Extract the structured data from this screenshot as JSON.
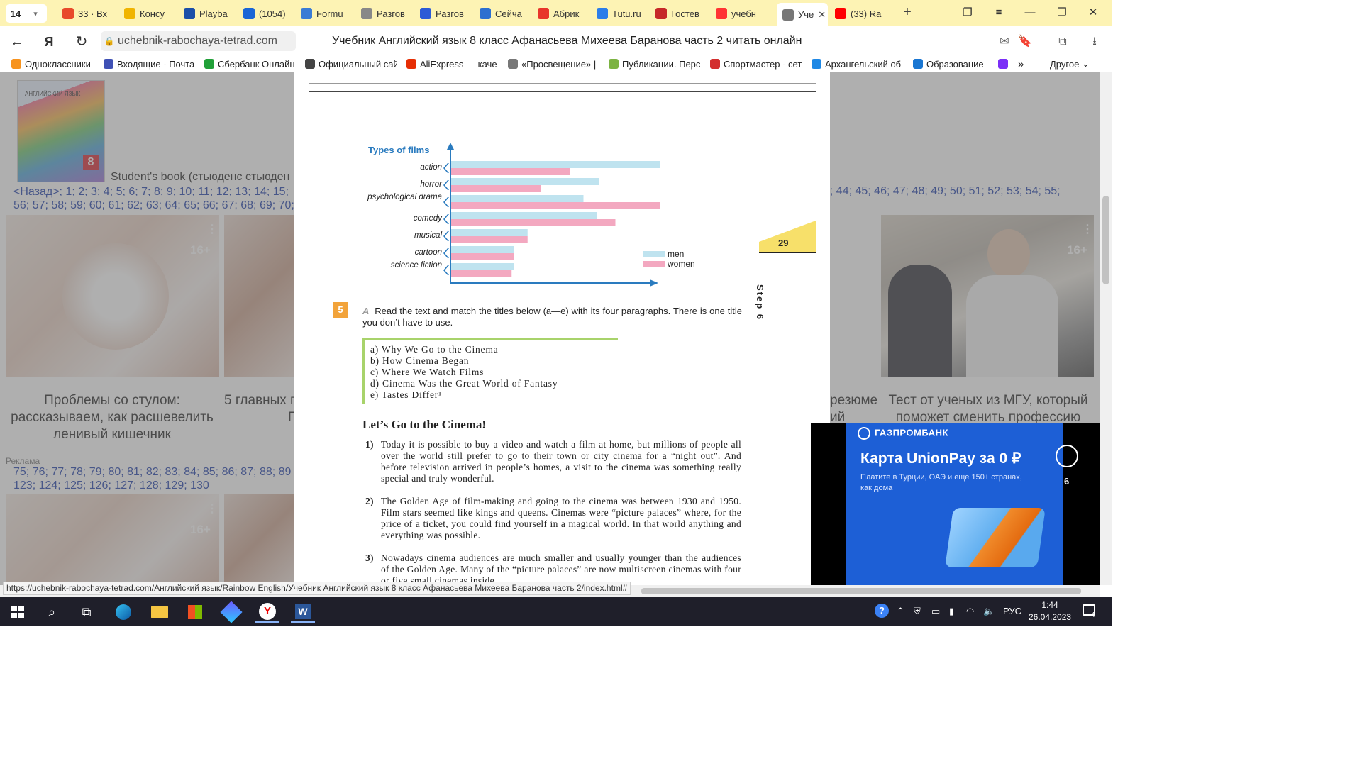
{
  "tabstrip": {
    "tab_count": "14",
    "tabs": [
      {
        "label": "33 · Вх",
        "color": "#e84a2b"
      },
      {
        "label": "Консу",
        "color": "#f0b400"
      },
      {
        "label": "Playba",
        "color": "#1b4fa8"
      },
      {
        "label": "(1054)",
        "color": "#1a66d6"
      },
      {
        "label": "Formu",
        "color": "#3a7bd5"
      },
      {
        "label": "Разгов",
        "color": "#888888"
      },
      {
        "label": "Разгов",
        "color": "#2c5bd6"
      },
      {
        "label": "Сейча",
        "color": "#2c6fd0"
      },
      {
        "label": "Абрик",
        "color": "#e8352b"
      },
      {
        "label": "Tutu.ru",
        "color": "#2b7de9"
      },
      {
        "label": "Гостев",
        "color": "#c62828"
      },
      {
        "label": "учебн",
        "color": "#f33"
      },
      {
        "label": "Уче",
        "color": "#777777",
        "active": true
      },
      {
        "label": "(33) Ra",
        "color": "#f00"
      }
    ]
  },
  "addressbar": {
    "url": "uchebnik-rabochaya-tetrad.com",
    "page_title": "Учебник Английский язык 8 класс Афанасьева Михеева Баранова часть 2 читать онлайн"
  },
  "bookmarks": [
    {
      "label": "Одноклассники",
      "color": "#f7931e"
    },
    {
      "label": "Входящие - Почта",
      "color": "#3f51b5"
    },
    {
      "label": "Сбербанк Онлайн",
      "color": "#21a038"
    },
    {
      "label": "Официальный сай",
      "color": "#444444"
    },
    {
      "label": "AliExpress — каче",
      "color": "#e62e04"
    },
    {
      "label": "«Просвещение» |",
      "color": "#777777"
    },
    {
      "label": "Публикации. Перс",
      "color": "#7cb342"
    },
    {
      "label": "Спортмастер - сет",
      "color": "#d32f2f"
    },
    {
      "label": "Архангельский об",
      "color": "#1e88e5"
    },
    {
      "label": "Образование",
      "color": "#1976d2"
    }
  ],
  "bookmarks_more": "Другое",
  "background": {
    "student_book": "Student's book (стьюденс стьюден",
    "links_row1": "<Назад>; 1; 2; 3; 4; 5; 6; 7; 8; 9; 10; 11; 12; 13; 14; 15;",
    "links_row1_right": "3; 44; 45; 46; 47; 48; 49; 50; 51; 52; 53; 54; 55;",
    "links_row2": "56; 57; 58; 59; 60; 61; 62; 63; 64; 65; 66; 67; 68; 69; 70;",
    "links_row3": "75; 76; 77; 78; 79; 80; 81; 82; 83; 84; 85; 86; 87; 88; 89",
    "links_row4": "123; 124; 125; 126; 127; 128; 129; 130",
    "card1_title": "Проблемы со стулом: рассказываем, как расшевелить ленивый кишечник",
    "card2_title": "5 главных п",
    "card2_title_b": "П",
    "card3_title": "резюме",
    "card3_title_b": "ий",
    "card4_title": "Тест от ученых из МГУ, который поможет сменить профессию",
    "age_badge": "16+",
    "ad_label": "Реклама"
  },
  "chart_data": {
    "type": "bar",
    "title": "Types of films",
    "categories": [
      "action",
      "horror",
      "psychological drama",
      "comedy",
      "musical",
      "cartoon",
      "science fiction"
    ],
    "series": [
      {
        "name": "men",
        "color": "#bfe3ef",
        "values": [
          85,
          56,
          50,
          55,
          29,
          24,
          24
        ]
      },
      {
        "name": "women",
        "color": "#f3a8c0",
        "values": [
          45,
          34,
          80,
          62,
          29,
          24,
          23
        ]
      }
    ],
    "xlim": [
      0,
      100
    ],
    "legend_position": "right"
  },
  "step": {
    "page_number": "29",
    "label": "Step 6"
  },
  "task": {
    "number": "5",
    "letter": "A",
    "instruction": "Read the text and match the titles below (a—e) with its four paragraphs. There is one title you don’t have to use.",
    "options": [
      "a) Why We Go to the Cinema",
      "b) How Cinema Began",
      "c) Where We Watch Films",
      "d) Cinema Was the Great World of Fantasy",
      "e) Tastes Differ¹"
    ],
    "heading": "Let’s Go to the Cinema!",
    "paragraphs": [
      {
        "n": "1)",
        "text": "Today it is possible to buy a video and watch a film at home, but millions of people all over the world still prefer to go to their town or city cinema for a “night out”. And before television arrived in people’s homes, a visit to the cinema was something really special and truly wonderful."
      },
      {
        "n": "2)",
        "text": "The Golden Age of film-making and going to the cinema was between 1930 and 1950. Film stars seemed like kings and queens. Cinemas were “picture palaces” where, for the price of a ticket, you could find yourself in a magical world. In that world anything and everything was possible."
      },
      {
        "n": "3)",
        "text": "Nowadays cinema audiences are much smaller and usually younger than the audiences of the Golden Age. Many of the “picture palaces” are now multiscreen cinemas with four or five small cinemas inside"
      }
    ]
  },
  "ad": {
    "brand": "ГАЗПРОМБАНК",
    "headline": "Карта UnionPay за 0 ₽",
    "subtext": "Платите в Турции, ОАЭ и еще 150+ странах, как дома",
    "counter": "6"
  },
  "status_url": "https://uchebnik-rabochaya-tetrad.com/Английский язык/Rainbow English/Учебник Английский язык 8 класс Афанасьева Михеева Баранова часть 2/index.html#",
  "taskbar": {
    "language": "РУС",
    "time": "1:44",
    "date": "26.04.2023",
    "notifications": "4"
  }
}
